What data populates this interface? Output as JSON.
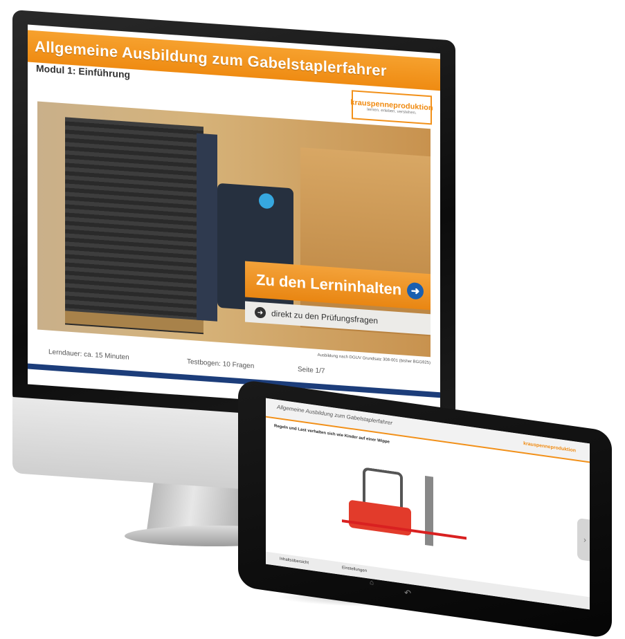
{
  "monitor": {
    "course_title": "Allgemeine Ausbildung zum Gabelstaplerfahrer",
    "module_title": "Modul 1: Einführung",
    "brand": {
      "name": "krauspenneproduktion",
      "tagline": "lernen. erleben. verstehen."
    },
    "cta_main": "Zu den Lerninhalten",
    "cta_secondary": "direkt zu den Prüfungsfragen",
    "caption": "Ausbildung nach DGUV Grundsatz 308-001 (bisher BGG925)",
    "stats": {
      "duration": "Lerndauer: ca. 15 Minuten",
      "test": "Testbogen: 10 Fragen",
      "page": "Seite 1/7"
    },
    "accent_color": "#f29018",
    "navy_color": "#1c3d7a"
  },
  "tablet": {
    "title": "Allgemeine Ausbildung zum Gabelstaplerfahrer",
    "logo": "krauspenneproduktion",
    "question": "Regeln und Last verhalten sich wie Kinder auf einer Wippe",
    "nav": {
      "left": "Inhaltsübersicht",
      "right": "Einstellungen"
    }
  }
}
